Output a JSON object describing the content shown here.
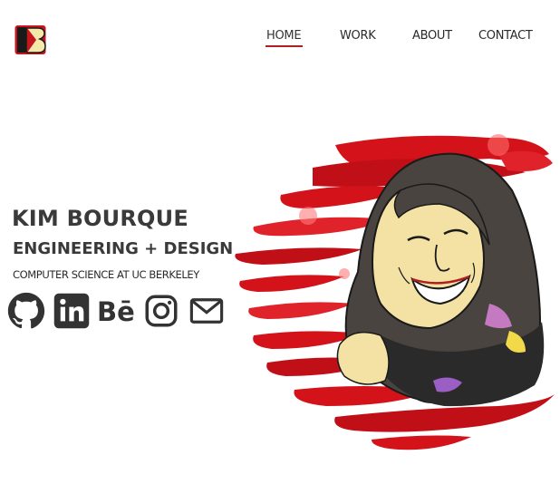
{
  "brand": {
    "logo_icon": "kb-monogram-logo",
    "colors": {
      "accent": "#b01e23",
      "brush": "#d3121a",
      "text": "#2a2a2a"
    }
  },
  "nav": {
    "items": [
      {
        "label": "HOME",
        "active": true
      },
      {
        "label": "WORK",
        "active": false
      },
      {
        "label": "ABOUT",
        "active": false
      },
      {
        "label": "CONTACT",
        "active": false
      }
    ]
  },
  "hero": {
    "name": "KIM BOURQUE",
    "tagline": "ENGINEERING + DESIGN",
    "school": "COMPUTER SCIENCE AT UC BERKELEY"
  },
  "social": [
    {
      "icon": "github-icon"
    },
    {
      "icon": "linkedin-icon"
    },
    {
      "icon": "behance-icon"
    },
    {
      "icon": "instagram-icon"
    },
    {
      "icon": "email-icon"
    }
  ],
  "illustration": {
    "icon": "portrait-illustration"
  }
}
